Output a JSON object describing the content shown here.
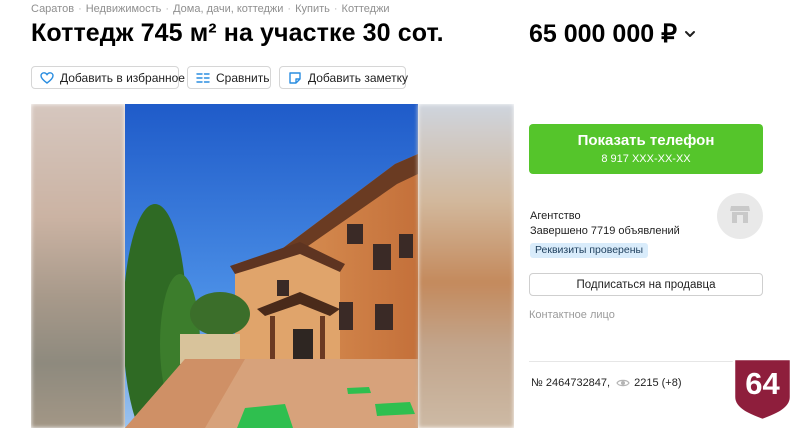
{
  "breadcrumbs": [
    "Саратов",
    "Недвижимость",
    "Дома, дачи, коттеджи",
    "Купить",
    "Коттеджи"
  ],
  "title": "Коттедж 745 м² на участке 30 сот.",
  "price": "65 000 000 ₽",
  "actions": {
    "favorite": "Добавить в избранное",
    "compare": "Сравнить",
    "note": "Добавить заметку"
  },
  "call": {
    "label": "Показать телефон",
    "phone": "8 917 XXX-XX-XX"
  },
  "seller": {
    "type": "Агентство",
    "stats": "Завершено 7719 объявлений",
    "verified": "Реквизиты проверены",
    "subscribe": "Подписаться на продавца",
    "contact": "Контактное лицо"
  },
  "listing": {
    "number": "№ 2464732847,",
    "views": "2215 (+8)"
  },
  "badge": {
    "text": "64",
    "color": "#8e1e3c"
  },
  "colors": {
    "accent_green": "#55c52b",
    "verified_bg": "#d9ecfb"
  },
  "icons": [
    "heart-icon",
    "compare-icon",
    "note-icon",
    "chevron-down-icon",
    "shop-icon",
    "eye-icon"
  ]
}
